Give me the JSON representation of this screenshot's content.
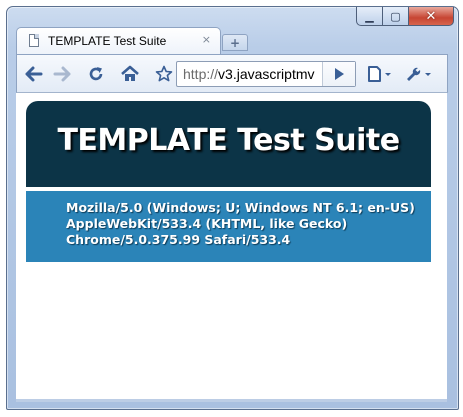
{
  "window": {
    "caption_buttons": {
      "minimize": "▁",
      "maximize": "▢",
      "close": "✕"
    }
  },
  "tab": {
    "title": "TEMPLATE Test Suite",
    "close": "×",
    "new_tab": "+"
  },
  "toolbar": {
    "back_icon": "back-arrow",
    "forward_icon": "forward-arrow",
    "reload_icon": "reload",
    "home_icon": "home",
    "bookmark_icon": "star",
    "url_protocol": "http://",
    "url_host": "v3.javascriptmv",
    "go_icon": "play",
    "page_menu_icon": "page",
    "tools_menu_icon": "wrench"
  },
  "page": {
    "title": "TEMPLATE Test Suite",
    "user_agent": "Mozilla/5.0 (Windows; U; Windows NT 6.1; en-US)\nAppleWebKit/533.4 (KHTML, like Gecko)\nChrome/5.0.375.99 Safari/533.4",
    "colors": {
      "banner": "#0c3447",
      "user_agent_bar": "#2b84b8"
    }
  }
}
